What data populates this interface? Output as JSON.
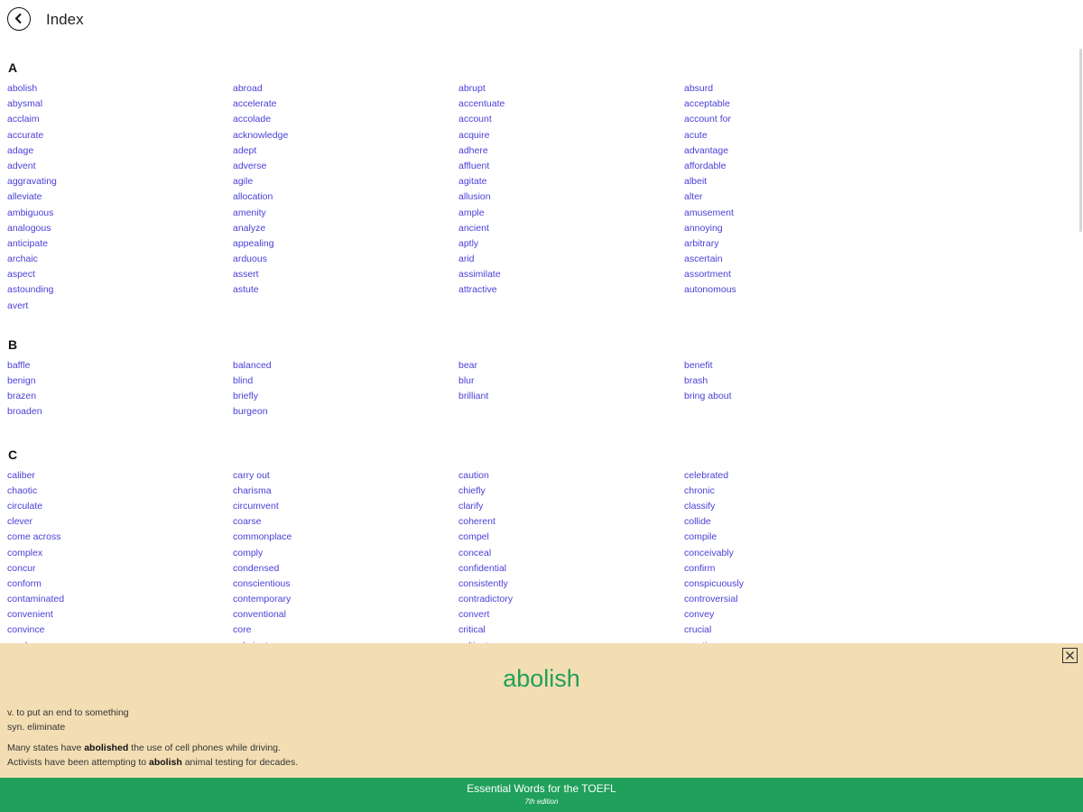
{
  "header": {
    "title": "Index",
    "back_icon": "chevron-left-circle-icon"
  },
  "sections": [
    {
      "letter": "A",
      "words": [
        "abolish",
        "abroad",
        "abrupt",
        "absurd",
        "abysmal",
        "accelerate",
        "accentuate",
        "acceptable",
        "acclaim",
        "accolade",
        "account",
        "account for",
        "accurate",
        "acknowledge",
        "acquire",
        "acute",
        "adage",
        "adept",
        "adhere",
        "advantage",
        "advent",
        "adverse",
        "affluent",
        "affordable",
        "aggravating",
        "agile",
        "agitate",
        "albeit",
        "alleviate",
        "allocation",
        "allusion",
        "alter",
        "ambiguous",
        "amenity",
        "ample",
        "amusement",
        "analogous",
        "analyze",
        "ancient",
        "annoying",
        "anticipate",
        "appealing",
        "aptly",
        "arbitrary",
        "archaic",
        "arduous",
        "arid",
        "ascertain",
        "aspect",
        "assert",
        "assimilate",
        "assortment",
        "astounding",
        "astute",
        "attractive",
        "autonomous",
        "avert"
      ]
    },
    {
      "letter": "B",
      "words": [
        "baffle",
        "balanced",
        "bear",
        "benefit",
        "benign",
        "blind",
        "blur",
        "brash",
        "brazen",
        "briefly",
        "brilliant",
        "bring about",
        "broaden",
        "burgeon"
      ]
    },
    {
      "letter": "C",
      "words": [
        "caliber",
        "carry out",
        "caution",
        "celebrated",
        "chaotic",
        "charisma",
        "chiefly",
        "chronic",
        "circulate",
        "circumvent",
        "clarify",
        "classify",
        "clever",
        "coarse",
        "coherent",
        "collide",
        "come across",
        "commonplace",
        "compel",
        "compile",
        "complex",
        "comply",
        "conceal",
        "conceivably",
        "concur",
        "condensed",
        "confidential",
        "confirm",
        "conform",
        "conscientious",
        "consistently",
        "conspicuously",
        "contaminated",
        "contemporary",
        "contradictory",
        "controversial",
        "convenient",
        "conventional",
        "convert",
        "convey",
        "convince",
        "core",
        "critical",
        "crucial",
        "crush",
        "culminate",
        "cultivate",
        "curative"
      ]
    }
  ],
  "definition": {
    "word": "abolish",
    "definition": "v. to put an end to something",
    "synonym": "syn. eliminate",
    "examples": [
      {
        "before": "Many states have ",
        "bold": "abolished",
        "after": " the use of cell phones while driving."
      },
      {
        "before": "Activists have been attempting to ",
        "bold": "abolish",
        "after": " animal testing for decades."
      }
    ],
    "close_icon": "close-icon"
  },
  "footer": {
    "title": "Essential Words for the TOEFL",
    "subtitle": "7th edition"
  },
  "colors": {
    "link": "#4a3fd6",
    "panel_bg": "#f3deb4",
    "accent_green": "#20a05a"
  }
}
